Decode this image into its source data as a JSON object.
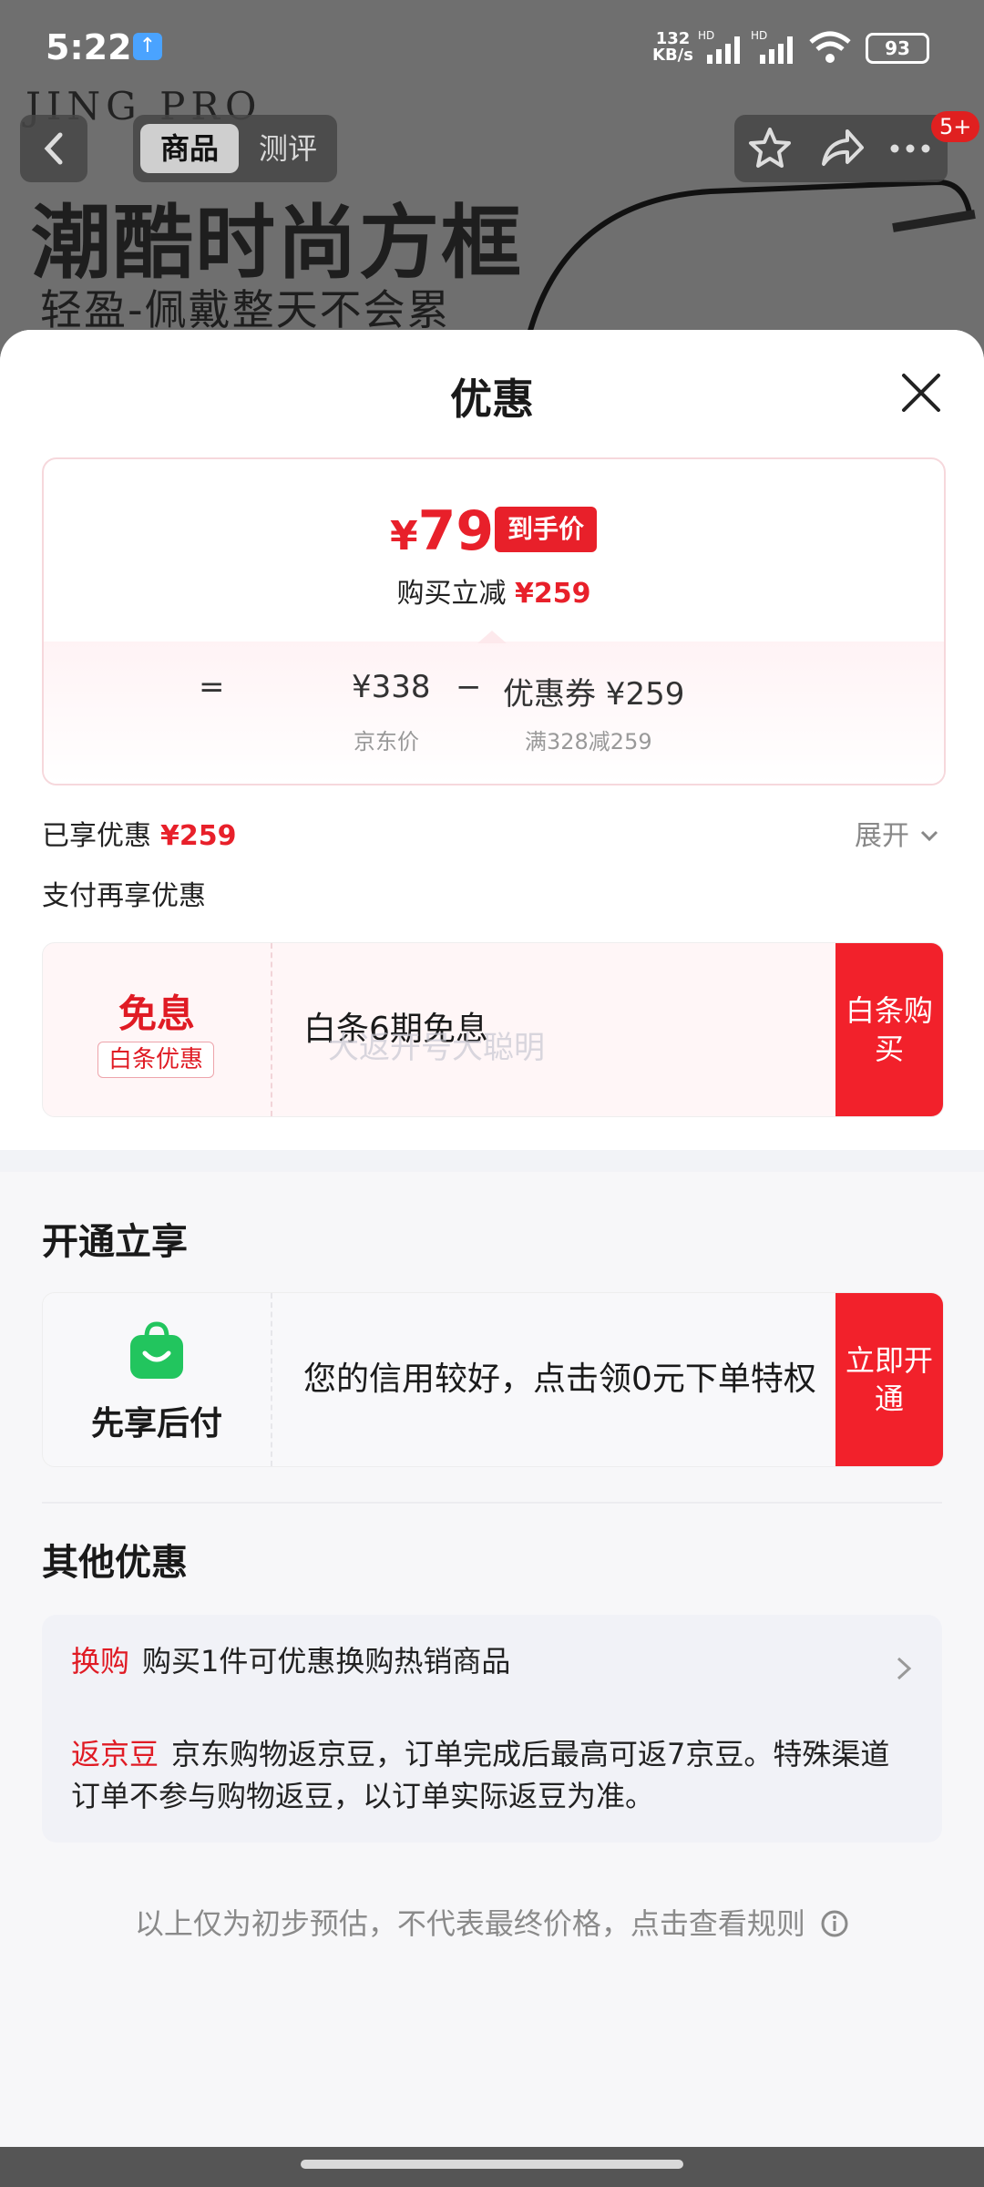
{
  "status_bar": {
    "time": "5:22",
    "net_speed_top": "132",
    "net_speed_bottom": "KB/s",
    "sig1": "HD",
    "sig2": "HD",
    "battery": "93"
  },
  "background": {
    "brand": "JING PRO",
    "headline": "潮酷时尚方框",
    "subline": "轻盈-佩戴整天不会累"
  },
  "top_nav": {
    "tab_goods": "商品",
    "tab_review": "测评",
    "badge": "5+"
  },
  "sheet": {
    "title": "优惠",
    "price_card": {
      "currency": "¥",
      "final_price": "79",
      "final_tag": "到手价",
      "reduce_label": "购买立减",
      "reduce_amount": "¥259",
      "equals": "=",
      "jd_price": "¥338",
      "minus": "−",
      "coupon_label": "优惠券 ¥259",
      "jd_price_label": "京东价",
      "coupon_rule": "满328减259"
    },
    "enjoyed_label": "已享优惠",
    "enjoyed_amount": "¥259",
    "expand_label": "展开",
    "pay_title": "支付再享优惠",
    "baitiao": {
      "big": "免息",
      "tag": "白条优惠",
      "text": "白条6期免息",
      "button": "白条购买",
      "watermark": "大返开号大聪明"
    },
    "open_section_title": "开通立享",
    "credit": {
      "label": "先享后付",
      "text": "您的信用较好，点击领0元下单特权",
      "button": "立即开通"
    },
    "other_section_title": "其他优惠",
    "other": [
      {
        "label": "换购",
        "text": "购买1件可优惠换购热销商品"
      },
      {
        "label": "返京豆",
        "text": "京东购物返京豆，订单完成后最高可返7京豆。特殊渠道订单不参与购物返豆，以订单实际返豆为准。"
      }
    ],
    "disclaimer": "以上仅为初步预估，不代表最终价格，点击查看规则"
  },
  "colors": {
    "accent_red": "#e8202a",
    "button_red": "#f2212b",
    "bag_green": "#22c55e"
  }
}
